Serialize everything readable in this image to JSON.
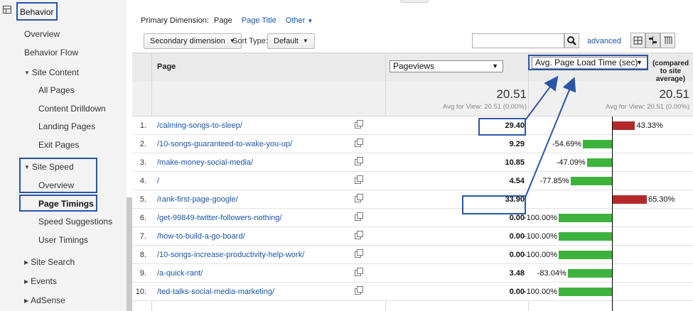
{
  "sidebar": {
    "behavior": "Behavior",
    "overview": "Overview",
    "behavior_flow": "Behavior Flow",
    "site_content": "Site Content",
    "all_pages": "All Pages",
    "content_drilldown": "Content Drilldown",
    "landing_pages": "Landing Pages",
    "exit_pages": "Exit Pages",
    "site_speed": "Site Speed",
    "speed_overview": "Overview",
    "page_timings": "Page Timings",
    "speed_suggestions": "Speed Suggestions",
    "user_timings": "User Timings",
    "site_search": "Site Search",
    "events": "Events",
    "adsense": "AdSense"
  },
  "toolbar": {
    "primary_dimension_label": "Primary Dimension:",
    "primary_page": "Page",
    "page_title": "Page Title",
    "other": "Other",
    "secondary_dimension": "Secondary dimension",
    "sort_type_label": "Sort Type:",
    "sort_default": "Default",
    "search_placeholder": "",
    "advanced": "advanced"
  },
  "table": {
    "header_page": "Page",
    "metric_select": "Pageviews",
    "compare_select": "Avg. Page Load Time (sec)",
    "compare_note": "(compared to site average)",
    "total_pageviews": "20.51",
    "total_pageviews_sub": "Avg for View: 20.51 (0.00%)",
    "total_compare": "20.51",
    "total_compare_sub": "Avg for View: 20.51 (0.00%)",
    "rows": [
      {
        "num": "1.",
        "page": "/calming-songs-to-sleep/",
        "value": "29.40",
        "pct": "43.33%",
        "pct_num": 43.33
      },
      {
        "num": "2.",
        "page": "/10-songs-guaranteed-to-wake-you-up/",
        "value": "9.29",
        "pct": "-54.69%",
        "pct_num": -54.69
      },
      {
        "num": "3.",
        "page": "/make-money-social-media/",
        "value": "10.85",
        "pct": "-47.09%",
        "pct_num": -47.09
      },
      {
        "num": "4.",
        "page": "/",
        "value": "4.54",
        "pct": "-77.85%",
        "pct_num": -77.85
      },
      {
        "num": "5.",
        "page": "/rank-first-page-google/",
        "value": "33.90",
        "pct": "65.30%",
        "pct_num": 65.3
      },
      {
        "num": "6.",
        "page": "/get-99849-twitter-followers-nothing/",
        "value": "0.00",
        "pct": "-100.00%",
        "pct_num": -100
      },
      {
        "num": "7.",
        "page": "/how-to-build-a-go-board/",
        "value": "0.00",
        "pct": "-100.00%",
        "pct_num": -100
      },
      {
        "num": "8.",
        "page": "/10-songs-increase-productivity-help-work/",
        "value": "0.00",
        "pct": "-100.00%",
        "pct_num": -100
      },
      {
        "num": "9.",
        "page": "/a-quick-rant/",
        "value": "3.48",
        "pct": "-83.04%",
        "pct_num": -83.04
      },
      {
        "num": "10.",
        "page": "/ted-talks-social-media-marketing/",
        "value": "0.00",
        "pct": "-100.00%",
        "pct_num": -100
      }
    ]
  },
  "colors": {
    "positive_bar": "#b22a2a",
    "negative_bar": "#3db33d",
    "link": "#1a55a8",
    "annotation": "#2b55a5"
  }
}
